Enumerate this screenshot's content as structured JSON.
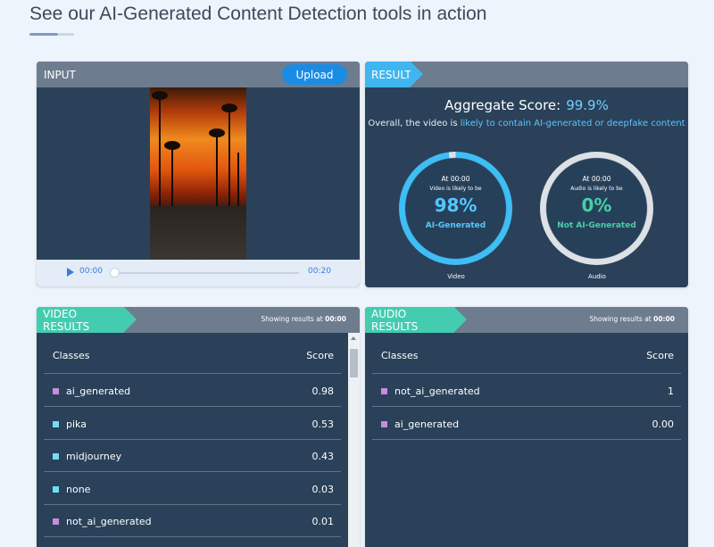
{
  "page": {
    "headline": "See our AI-Generated Content Detection tools in action"
  },
  "input_panel": {
    "label": "INPUT",
    "upload_label": "Upload",
    "player": {
      "current_time": "00:00",
      "duration": "00:20",
      "progress": 0
    }
  },
  "result_panel": {
    "label": "RESULT",
    "aggregate_label": "Aggregate Score:",
    "aggregate_value": "99.9%",
    "summary_prefix": "Overall, the video is ",
    "summary_highlight": "likely to contain AI-generated or deepfake content",
    "video_gauge": {
      "at": "At 00:00",
      "likely": "Video is likely to be",
      "percent": "98%",
      "verdict": "AI-Generated",
      "caption": "Video",
      "fraction": 0.98,
      "color": "#3fbef5"
    },
    "audio_gauge": {
      "at": "At 00:00",
      "likely": "Audio is likely to be",
      "percent": "0%",
      "verdict": "Not AI-Generated",
      "caption": "Audio",
      "fraction": 0.0,
      "color": "#dde1e6"
    }
  },
  "video_results": {
    "label": "VIDEO RESULTS",
    "showing": "Showing results at ",
    "showing_time": "00:00",
    "col_classes": "Classes",
    "col_score": "Score",
    "rows": [
      {
        "name": "ai_generated",
        "score": "0.98",
        "color": "#c98be0"
      },
      {
        "name": "pika",
        "score": "0.53",
        "color": "#6ee0f0"
      },
      {
        "name": "midjourney",
        "score": "0.43",
        "color": "#6ee0f0"
      },
      {
        "name": "none",
        "score": "0.03",
        "color": "#6ee0f0"
      },
      {
        "name": "not_ai_generated",
        "score": "0.01",
        "color": "#c98be0"
      }
    ]
  },
  "audio_results": {
    "label": "AUDIO RESULTS",
    "showing": "Showing results at ",
    "showing_time": "00:00",
    "col_classes": "Classes",
    "col_score": "Score",
    "rows": [
      {
        "name": "not_ai_generated",
        "score": "1",
        "color": "#c98be0"
      },
      {
        "name": "ai_generated",
        "score": "0.00",
        "color": "#c98be0"
      }
    ]
  }
}
